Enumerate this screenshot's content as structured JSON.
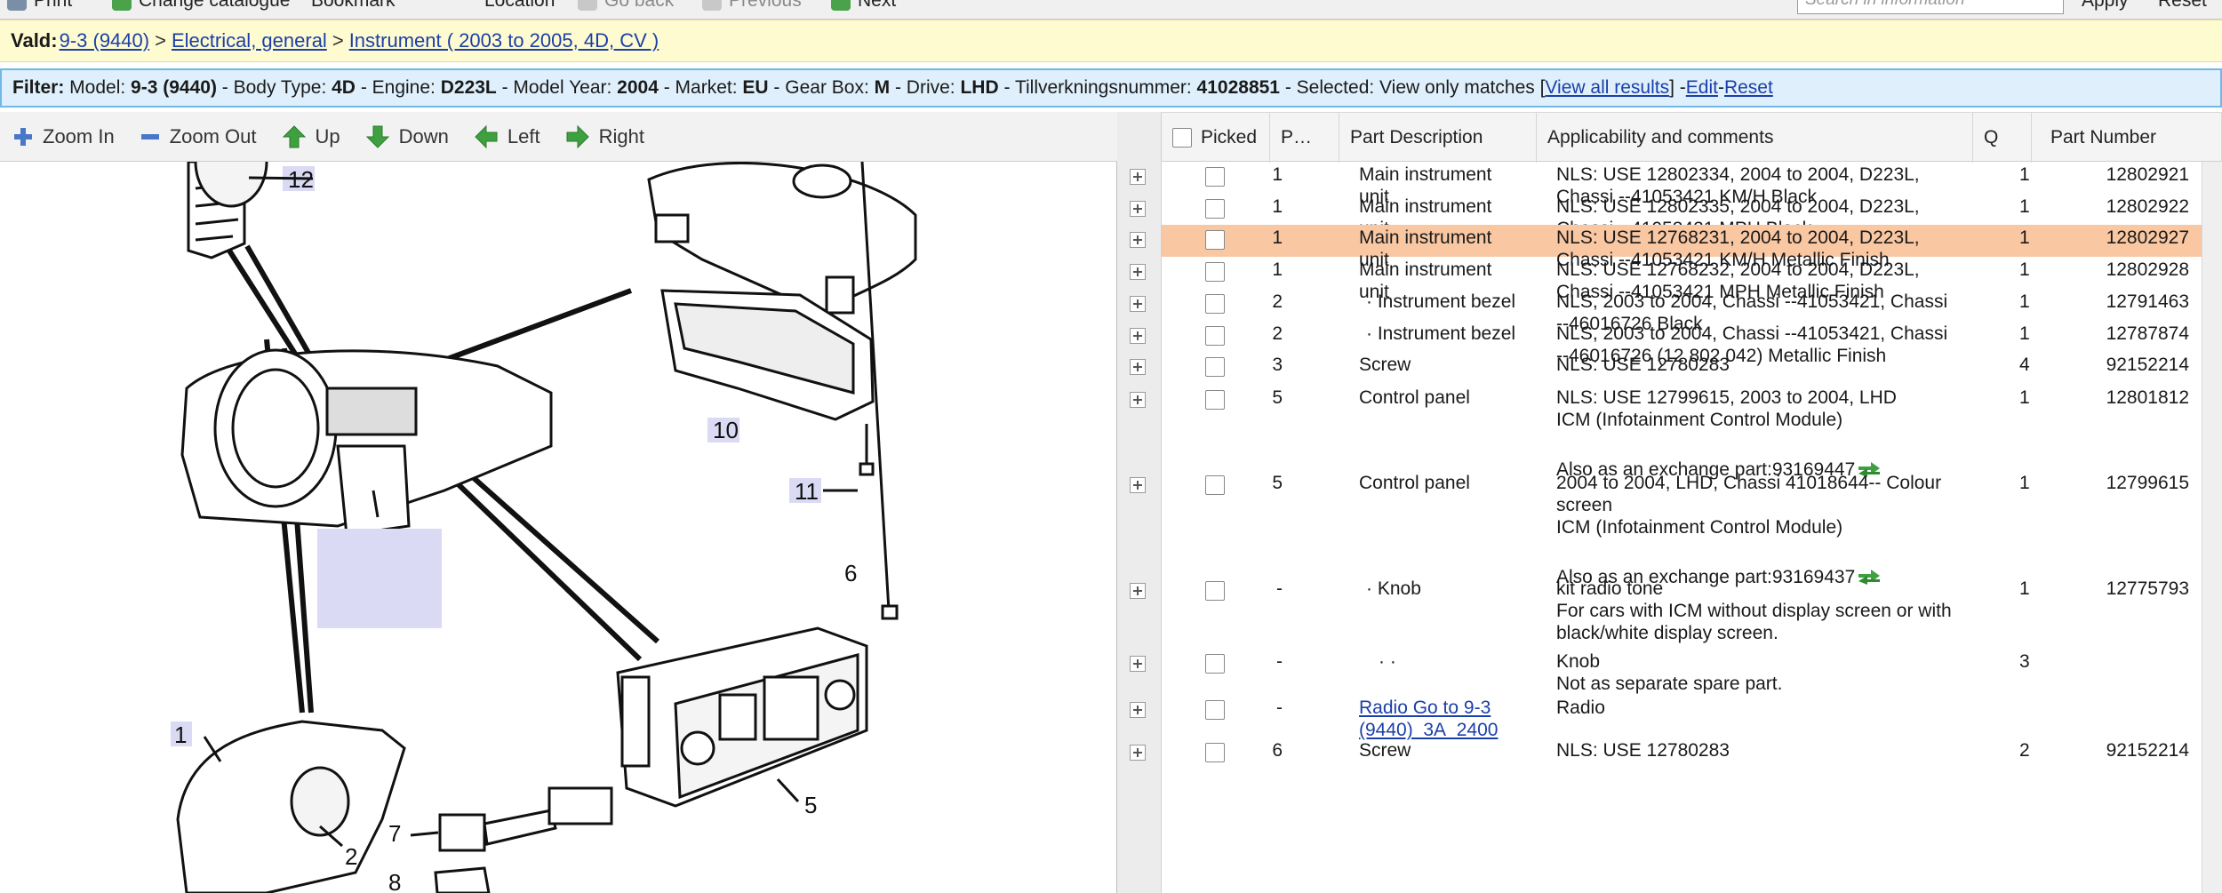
{
  "toolbar": {
    "print": "Print",
    "change_catalogue": "Change catalogue",
    "bookmark": "Bookmark",
    "location": "Location",
    "go_back": "Go back",
    "previous": "Previous",
    "next": "Next",
    "search_placeholder": "Search in information",
    "apply": "Apply",
    "reset": "Reset"
  },
  "breadcrumb": {
    "label": "Vald:",
    "items": [
      "9-3 (9440)",
      "Electrical, general",
      "Instrument ( 2003 to 2005, 4D, CV )"
    ],
    "separator": ">"
  },
  "filter": {
    "label": "Filter:",
    "parts": [
      {
        "k": " Model: ",
        "v": "9-3 (9440)"
      },
      {
        "k": " - Body Type: ",
        "v": "4D"
      },
      {
        "k": " - Engine: ",
        "v": "D223L"
      },
      {
        "k": " - Model Year: ",
        "v": "2004"
      },
      {
        "k": " - Market: ",
        "v": "EU"
      },
      {
        "k": " - Gear Box: ",
        "v": "M"
      },
      {
        "k": " - Drive: ",
        "v": "LHD"
      },
      {
        "k": " - Tillverkningsnummer: ",
        "v": "41028851"
      },
      {
        "k": " - Selected: ",
        "v": ""
      }
    ],
    "view_only": "View only matches [",
    "view_all": "View all results",
    "close_bracket": "] - ",
    "edit": "Edit",
    "dash": " - ",
    "reset": "Reset"
  },
  "diagram_nav": {
    "zoom_in": "Zoom In",
    "zoom_out": "Zoom Out",
    "up": "Up",
    "down": "Down",
    "left": "Left",
    "right": "Right"
  },
  "diagram_labels": [
    "12",
    "10",
    "11",
    "6",
    "1",
    "2",
    "5",
    "7",
    "8"
  ],
  "table": {
    "headers": {
      "picked": "Picked",
      "pos": "P…",
      "desc": "Part Description",
      "appl": "Applicability and comments",
      "q": "Q",
      "part": "Part Number"
    },
    "rows": [
      {
        "pos": "1",
        "desc": [
          "Main instrument",
          "unit"
        ],
        "appl": [
          "NLS: USE 12802334, 2004 to 2004, D223L,",
          "Chassi --41053421 KM/H Black"
        ],
        "q": "1",
        "part": "12802921"
      },
      {
        "pos": "1",
        "desc": [
          "Main instrument",
          "unit"
        ],
        "appl": [
          "NLS: USE 12802335, 2004 to 2004, D223L,",
          "Chassi --41053421 MPH Black"
        ],
        "q": "1",
        "part": "12802922"
      },
      {
        "pos": "1",
        "desc": [
          "Main instrument",
          "unit"
        ],
        "appl": [
          "NLS: USE 12768231, 2004 to 2004, D223L,",
          "Chassi --41053421 KM/H Metallic Finish"
        ],
        "q": "1",
        "part": "12802927",
        "highlight": true
      },
      {
        "pos": "1",
        "desc": [
          "Main instrument",
          "unit"
        ],
        "appl": [
          "NLS: USE 12768232, 2004 to 2004, D223L,",
          "Chassi --41053421 MPH Metallic Finish"
        ],
        "q": "1",
        "part": "12802928"
      },
      {
        "pos": "2",
        "desc": [
          "· Instrument bezel"
        ],
        "appl": [
          "NLS, 2003 to 2004, Chassi --41053421, Chassi",
          "--46016726 Black"
        ],
        "q": "1",
        "part": "12791463"
      },
      {
        "pos": "2",
        "desc": [
          "· Instrument bezel"
        ],
        "appl": [
          "NLS, 2003 to 2004, Chassi --41053421, Chassi",
          "--46016726 (12 802 042) Metallic Finish"
        ],
        "q": "1",
        "part": "12787874"
      },
      {
        "pos": "3",
        "desc": [
          "Screw"
        ],
        "appl": [
          "NLS: USE 12780283"
        ],
        "q": "4",
        "part": "92152214"
      },
      {
        "pos": "5",
        "desc": [
          "Control panel"
        ],
        "appl": [
          "NLS: USE 12799615, 2003 to 2004, LHD",
          "ICM (Infotainment Control Module)",
          "",
          "Also as an exchange part:93169447"
        ],
        "q": "1",
        "part": "12801812",
        "exchange": true
      },
      {
        "pos": "5",
        "desc": [
          "Control panel"
        ],
        "appl": [
          "2004 to 2004, LHD, Chassi 41018644-- Colour",
          "screen",
          "ICM (Infotainment Control Module)",
          "",
          "Also as an exchange part:93169437"
        ],
        "q": "1",
        "part": "12799615",
        "exchange": true
      },
      {
        "pos": "-",
        "desc": [
          "· Knob"
        ],
        "appl": [
          "kit radio tone",
          "For cars with ICM without display screen or with",
          "black/white display screen."
        ],
        "q": "1",
        "part": "12775793"
      },
      {
        "pos": "-",
        "desc": [
          "· ·"
        ],
        "appl": [
          "Knob",
          "Not as separate spare part."
        ],
        "q": "3",
        "part": ""
      },
      {
        "pos": "-",
        "desc": [
          "Radio Go to 9-3",
          "(9440)_3A_2400"
        ],
        "appl": [
          "Radio"
        ],
        "q": "",
        "part": "",
        "desc_link": true
      },
      {
        "pos": "6",
        "desc": [
          "Screw"
        ],
        "appl": [
          "NLS: USE 12780283"
        ],
        "q": "2",
        "part": "92152214"
      }
    ]
  }
}
